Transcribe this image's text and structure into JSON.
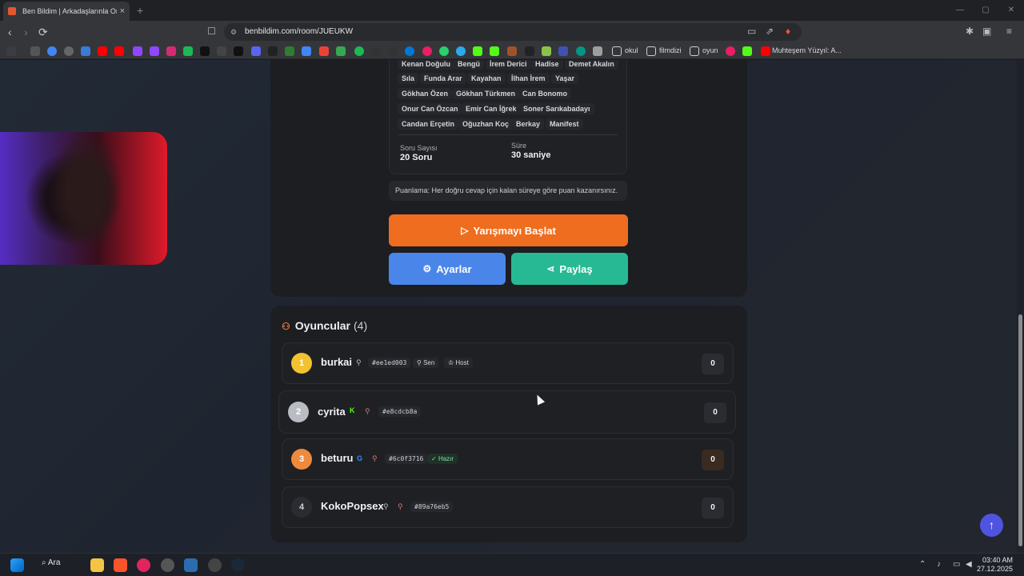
{
  "browser": {
    "tab_title": "Ben Bildim | Arkadaşlarınla Onlin",
    "tab_close": "×",
    "new_tab": "+",
    "win_min": "—",
    "win_max": "▢",
    "win_close": "✕",
    "url": "benbildim.com/room/JUEUKW",
    "back": "‹",
    "forward": "›",
    "reload": "⟳"
  },
  "bookmarks": {
    "folders": [
      "okul",
      "filmdizi",
      "oyun"
    ],
    "last": "Muhteşem Yüzyıl: A..."
  },
  "categories": {
    "chips": [
      "Kenan Doğulu",
      "Bengü",
      "İrem Derici",
      "Hadise",
      "Demet Akalın",
      "Sıla",
      "Funda Arar",
      "Kayahan",
      "İlhan İrem",
      "Yaşar",
      "Gökhan Özen",
      "Gökhan Türkmen",
      "Can Bonomo",
      "Onur Can Özcan",
      "Emir Can İğrek",
      "Soner Sarıkabadayı",
      "Candan Erçetin",
      "Oğuzhan Koç",
      "Berkay",
      "Manifest"
    ]
  },
  "stats": {
    "questions_label": "Soru Sayısı",
    "questions_value": "20 Soru",
    "time_label": "Süre",
    "time_value": "30 saniye"
  },
  "info_text": "Puanlama: Her doğru cevap için kalan süreye göre puan kazanırsınız.",
  "buttons": {
    "start": "Yarışmayı Başlat",
    "settings": "Ayarlar",
    "share": "Paylaş"
  },
  "players": {
    "title": "Oyuncular",
    "count": "(4)",
    "rows": [
      {
        "rank": "1",
        "name": "burkai",
        "tag": "#ee1ed003",
        "badges": [
          "Sen",
          "Host"
        ],
        "score": "0"
      },
      {
        "rank": "2",
        "name": "cyrita",
        "tag": "#e8cdcb8a",
        "badges": [],
        "score": "0"
      },
      {
        "rank": "3",
        "name": "beturu",
        "tag": "#6c0f3716",
        "badges": [
          "Hazır"
        ],
        "score": "0"
      },
      {
        "rank": "4",
        "name": "KokoPopsex",
        "tag": "#89a76eb5",
        "badges": [],
        "score": "0"
      }
    ]
  },
  "taskbar": {
    "search": "Ara",
    "time": "03:40 AM",
    "date": "27.12.2025"
  },
  "colors": {
    "start": "#ee6d1f",
    "settings": "#4a86ea",
    "share": "#27b994",
    "rank1": "#f2c230",
    "rank2": "#b9bcc3",
    "rank3": "#ee8a3c",
    "rank4": "#2a2c31"
  }
}
